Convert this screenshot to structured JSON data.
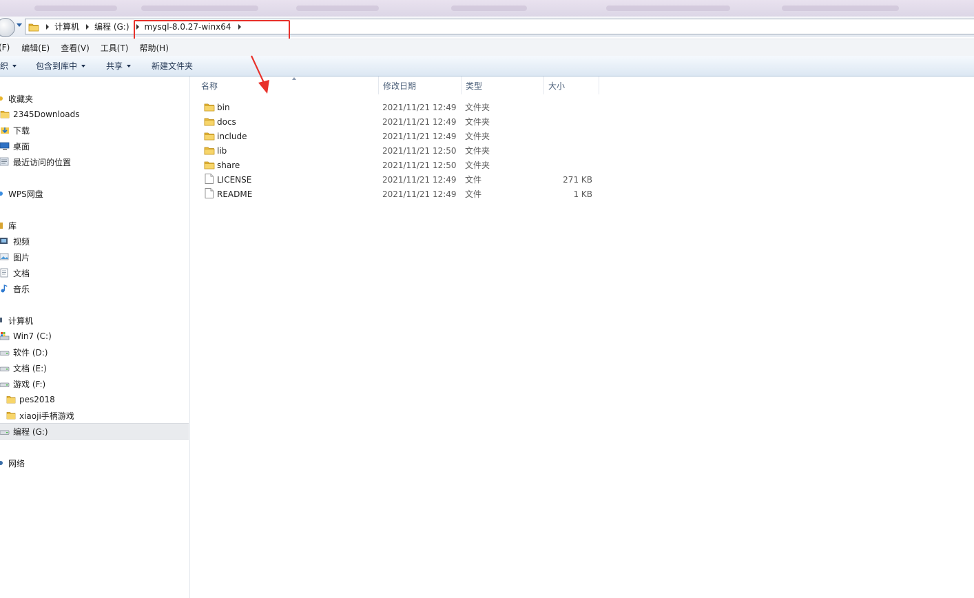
{
  "breadcrumb": {
    "items": [
      "计算机",
      "编程 (G:)",
      "mysql-8.0.27-winx64"
    ]
  },
  "menubar": {
    "items": [
      "(F)",
      "编辑(E)",
      "查看(V)",
      "工具(T)",
      "帮助(H)"
    ]
  },
  "commandbar": {
    "organize": "织",
    "include_in_library": "包含到库中",
    "share": "共享",
    "new_folder": "新建文件夹"
  },
  "navpane": {
    "items": [
      {
        "label": "收藏夹",
        "icon": "star-icon",
        "indent": 0
      },
      {
        "label": "2345Downloads",
        "icon": "folder-icon",
        "indent": 1
      },
      {
        "label": "下载",
        "icon": "download-folder-icon",
        "indent": 1
      },
      {
        "label": "桌面",
        "icon": "desktop-icon",
        "indent": 1
      },
      {
        "label": "最近访问的位置",
        "icon": "recent-places-icon",
        "indent": 1
      },
      {
        "label": "WPS网盘",
        "icon": "cloud-drive-icon",
        "indent": 0
      },
      {
        "label": "库",
        "icon": "library-icon",
        "indent": 0
      },
      {
        "label": "视频",
        "icon": "video-library-icon",
        "indent": 1
      },
      {
        "label": "图片",
        "icon": "pictures-library-icon",
        "indent": 1
      },
      {
        "label": "文档",
        "icon": "documents-library-icon",
        "indent": 1
      },
      {
        "label": "音乐",
        "icon": "music-library-icon",
        "indent": 1
      },
      {
        "label": "计算机",
        "icon": "computer-icon",
        "indent": 0
      },
      {
        "label": "Win7 (C:)",
        "icon": "system-drive-icon",
        "indent": 1
      },
      {
        "label": "软件 (D:)",
        "icon": "drive-icon",
        "indent": 1
      },
      {
        "label": "文档 (E:)",
        "icon": "drive-icon",
        "indent": 1
      },
      {
        "label": "游戏 (F:)",
        "icon": "drive-icon",
        "indent": 1
      },
      {
        "label": "pes2018",
        "icon": "folder-icon",
        "indent": 2
      },
      {
        "label": "xiaoji手柄游戏",
        "icon": "folder-icon",
        "indent": 2
      },
      {
        "label": "编程 (G:)",
        "icon": "drive-icon",
        "indent": 1,
        "selected": true
      },
      {
        "label": "网络",
        "icon": "network-icon",
        "indent": 0
      }
    ]
  },
  "columns": {
    "name": "名称",
    "modified": "修改日期",
    "type": "类型",
    "size": "大小"
  },
  "files": [
    {
      "name": "bin",
      "modified": "2021/11/21 12:49",
      "type": "文件夹",
      "size": "",
      "icon": "folder-icon"
    },
    {
      "name": "docs",
      "modified": "2021/11/21 12:49",
      "type": "文件夹",
      "size": "",
      "icon": "folder-icon"
    },
    {
      "name": "include",
      "modified": "2021/11/21 12:49",
      "type": "文件夹",
      "size": "",
      "icon": "folder-icon"
    },
    {
      "name": "lib",
      "modified": "2021/11/21 12:50",
      "type": "文件夹",
      "size": "",
      "icon": "folder-icon"
    },
    {
      "name": "share",
      "modified": "2021/11/21 12:50",
      "type": "文件夹",
      "size": "",
      "icon": "folder-icon"
    },
    {
      "name": "LICENSE",
      "modified": "2021/11/21 12:49",
      "type": "文件",
      "size": "271 KB",
      "icon": "file-icon"
    },
    {
      "name": "README",
      "modified": "2021/11/21 12:49",
      "type": "文件",
      "size": "1 KB",
      "icon": "file-icon"
    }
  ],
  "colors": {
    "highlight_box": "#e8312a",
    "annotation_arrow": "#e8312a"
  }
}
